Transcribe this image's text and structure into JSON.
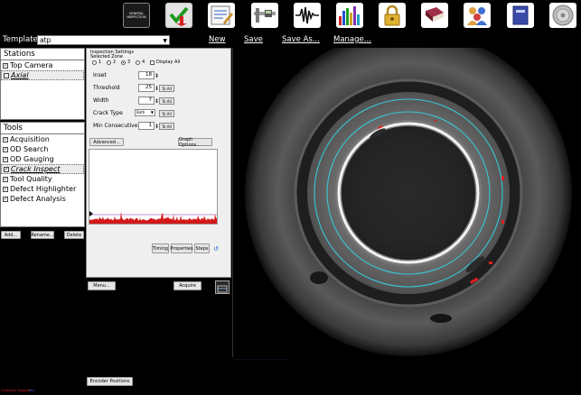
{
  "toolbar": {
    "general_inspection_label_1": "GENERAL",
    "general_inspection_label_2": "INSPECTION",
    "buttons": [
      "general-inspection",
      "check-download",
      "notepad",
      "caliper",
      "waveform",
      "bar-chart",
      "lock",
      "book",
      "users",
      "manual",
      "disc"
    ]
  },
  "template": {
    "label": "Template:",
    "value": "atp",
    "links": {
      "new": "New",
      "save": "Save",
      "save_as": "Save As...",
      "manage": "Manage..."
    }
  },
  "stations": {
    "title": "Stations",
    "items": [
      {
        "label": "Top Camera",
        "checked": true,
        "selected": false
      },
      {
        "label": "Axial",
        "checked": false,
        "selected": true
      }
    ]
  },
  "tools": {
    "title": "Tools",
    "items": [
      {
        "label": "Acquisition",
        "checked": true,
        "selected": false
      },
      {
        "label": "OD Search",
        "checked": true,
        "selected": false
      },
      {
        "label": "OD Gauging",
        "checked": true,
        "selected": false
      },
      {
        "label": "Crack Inspect",
        "checked": true,
        "selected": true
      },
      {
        "label": "Tool Quality",
        "checked": true,
        "selected": false
      },
      {
        "label": "Defect Highlighter",
        "checked": true,
        "selected": false
      },
      {
        "label": "Defect Analysis",
        "checked": true,
        "selected": false
      }
    ],
    "buttons": {
      "add": "Add...",
      "rename": "Rename...",
      "delete": "Delete"
    }
  },
  "settings": {
    "title": "Inspection Settings",
    "selected_zone_label": "Selected Zone",
    "zones": [
      "1",
      "2",
      "3",
      "4"
    ],
    "selected_zone": "3",
    "display_all": "Display All",
    "fields": {
      "inset": {
        "label": "Inset",
        "value": "18"
      },
      "threshold": {
        "label": "Threshold",
        "value": "25"
      },
      "width": {
        "label": "Width",
        "value": "7"
      },
      "crack_type": {
        "label": "Crack Type",
        "value": "Both"
      },
      "min_consecutive": {
        "label": "Min Consecutive",
        "value": "1"
      }
    },
    "to_all": "To All",
    "advanced": "Advanced...",
    "graph_options": "Graph Options...",
    "timing": "Timing",
    "properties": "Properties",
    "steps": "Steps"
  },
  "bottom": {
    "menu": "Menu...",
    "acquire": "Acquire",
    "encoder_positions": "Encoder Positions"
  },
  "status": {
    "left": "Controller Stopped",
    "right": "Idle"
  },
  "colors": {
    "overlay_cyan": "#39c6d6",
    "defect_red": "#e0201c",
    "graph_signal": "#d41818",
    "threshold_line": "#7f2fa8"
  }
}
